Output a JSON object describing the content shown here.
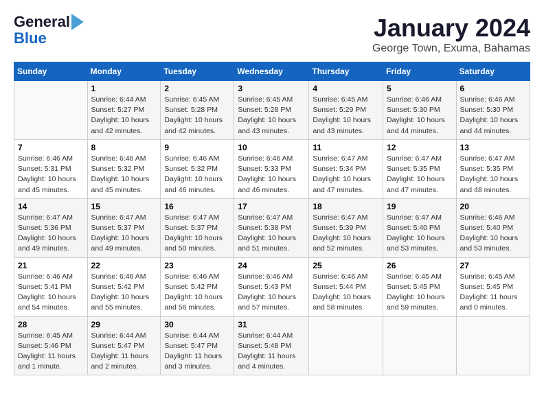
{
  "header": {
    "logo_general": "General",
    "logo_blue": "Blue",
    "month_title": "January 2024",
    "location": "George Town, Exuma, Bahamas"
  },
  "days_of_week": [
    "Sunday",
    "Monday",
    "Tuesday",
    "Wednesday",
    "Thursday",
    "Friday",
    "Saturday"
  ],
  "weeks": [
    [
      {
        "day": "",
        "info": ""
      },
      {
        "day": "1",
        "info": "Sunrise: 6:44 AM\nSunset: 5:27 PM\nDaylight: 10 hours\nand 42 minutes."
      },
      {
        "day": "2",
        "info": "Sunrise: 6:45 AM\nSunset: 5:28 PM\nDaylight: 10 hours\nand 42 minutes."
      },
      {
        "day": "3",
        "info": "Sunrise: 6:45 AM\nSunset: 5:28 PM\nDaylight: 10 hours\nand 43 minutes."
      },
      {
        "day": "4",
        "info": "Sunrise: 6:45 AM\nSunset: 5:29 PM\nDaylight: 10 hours\nand 43 minutes."
      },
      {
        "day": "5",
        "info": "Sunrise: 6:46 AM\nSunset: 5:30 PM\nDaylight: 10 hours\nand 44 minutes."
      },
      {
        "day": "6",
        "info": "Sunrise: 6:46 AM\nSunset: 5:30 PM\nDaylight: 10 hours\nand 44 minutes."
      }
    ],
    [
      {
        "day": "7",
        "info": "Sunrise: 6:46 AM\nSunset: 5:31 PM\nDaylight: 10 hours\nand 45 minutes."
      },
      {
        "day": "8",
        "info": "Sunrise: 6:46 AM\nSunset: 5:32 PM\nDaylight: 10 hours\nand 45 minutes."
      },
      {
        "day": "9",
        "info": "Sunrise: 6:46 AM\nSunset: 5:32 PM\nDaylight: 10 hours\nand 46 minutes."
      },
      {
        "day": "10",
        "info": "Sunrise: 6:46 AM\nSunset: 5:33 PM\nDaylight: 10 hours\nand 46 minutes."
      },
      {
        "day": "11",
        "info": "Sunrise: 6:47 AM\nSunset: 5:34 PM\nDaylight: 10 hours\nand 47 minutes."
      },
      {
        "day": "12",
        "info": "Sunrise: 6:47 AM\nSunset: 5:35 PM\nDaylight: 10 hours\nand 47 minutes."
      },
      {
        "day": "13",
        "info": "Sunrise: 6:47 AM\nSunset: 5:35 PM\nDaylight: 10 hours\nand 48 minutes."
      }
    ],
    [
      {
        "day": "14",
        "info": "Sunrise: 6:47 AM\nSunset: 5:36 PM\nDaylight: 10 hours\nand 49 minutes."
      },
      {
        "day": "15",
        "info": "Sunrise: 6:47 AM\nSunset: 5:37 PM\nDaylight: 10 hours\nand 49 minutes."
      },
      {
        "day": "16",
        "info": "Sunrise: 6:47 AM\nSunset: 5:37 PM\nDaylight: 10 hours\nand 50 minutes."
      },
      {
        "day": "17",
        "info": "Sunrise: 6:47 AM\nSunset: 5:38 PM\nDaylight: 10 hours\nand 51 minutes."
      },
      {
        "day": "18",
        "info": "Sunrise: 6:47 AM\nSunset: 5:39 PM\nDaylight: 10 hours\nand 52 minutes."
      },
      {
        "day": "19",
        "info": "Sunrise: 6:47 AM\nSunset: 5:40 PM\nDaylight: 10 hours\nand 53 minutes."
      },
      {
        "day": "20",
        "info": "Sunrise: 6:46 AM\nSunset: 5:40 PM\nDaylight: 10 hours\nand 53 minutes."
      }
    ],
    [
      {
        "day": "21",
        "info": "Sunrise: 6:46 AM\nSunset: 5:41 PM\nDaylight: 10 hours\nand 54 minutes."
      },
      {
        "day": "22",
        "info": "Sunrise: 6:46 AM\nSunset: 5:42 PM\nDaylight: 10 hours\nand 55 minutes."
      },
      {
        "day": "23",
        "info": "Sunrise: 6:46 AM\nSunset: 5:42 PM\nDaylight: 10 hours\nand 56 minutes."
      },
      {
        "day": "24",
        "info": "Sunrise: 6:46 AM\nSunset: 5:43 PM\nDaylight: 10 hours\nand 57 minutes."
      },
      {
        "day": "25",
        "info": "Sunrise: 6:46 AM\nSunset: 5:44 PM\nDaylight: 10 hours\nand 58 minutes."
      },
      {
        "day": "26",
        "info": "Sunrise: 6:45 AM\nSunset: 5:45 PM\nDaylight: 10 hours\nand 59 minutes."
      },
      {
        "day": "27",
        "info": "Sunrise: 6:45 AM\nSunset: 5:45 PM\nDaylight: 11 hours\nand 0 minutes."
      }
    ],
    [
      {
        "day": "28",
        "info": "Sunrise: 6:45 AM\nSunset: 5:46 PM\nDaylight: 11 hours\nand 1 minute."
      },
      {
        "day": "29",
        "info": "Sunrise: 6:44 AM\nSunset: 5:47 PM\nDaylight: 11 hours\nand 2 minutes."
      },
      {
        "day": "30",
        "info": "Sunrise: 6:44 AM\nSunset: 5:47 PM\nDaylight: 11 hours\nand 3 minutes."
      },
      {
        "day": "31",
        "info": "Sunrise: 6:44 AM\nSunset: 5:48 PM\nDaylight: 11 hours\nand 4 minutes."
      },
      {
        "day": "",
        "info": ""
      },
      {
        "day": "",
        "info": ""
      },
      {
        "day": "",
        "info": ""
      }
    ]
  ]
}
